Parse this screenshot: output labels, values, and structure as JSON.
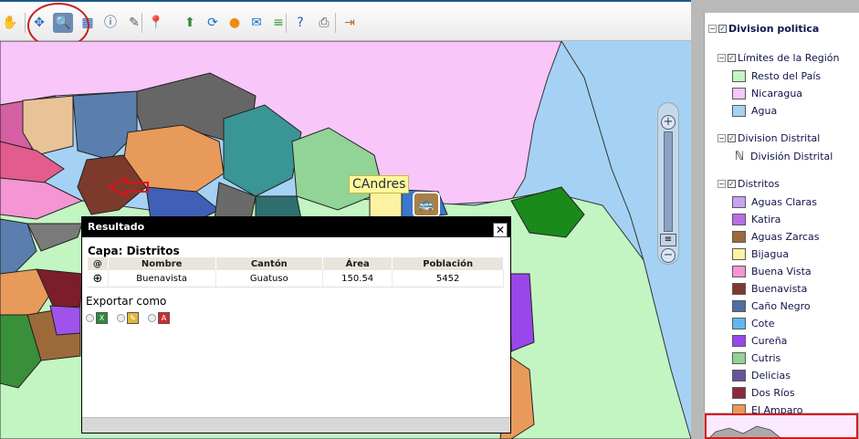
{
  "toolbar": {
    "tools": [
      {
        "icon": "hand-icon",
        "glyph": "✋",
        "color": "#c07a22"
      },
      {
        "icon": "pan-arrows-icon",
        "glyph": "✥",
        "color": "#2c6fb6"
      },
      {
        "icon": "identify-magnifier-icon",
        "glyph": "🔍",
        "color": "#1f4e8c"
      },
      {
        "icon": "select-box-icon",
        "glyph": "▦",
        "color": "#1b62b5"
      },
      {
        "icon": "info-icon",
        "glyph": "ⓘ",
        "color": "#1f4e8c"
      },
      {
        "icon": "measure-ruler-icon",
        "glyph": "✎",
        "color": "#5a5a5a"
      },
      {
        "icon": "location-pin-icon",
        "glyph": "📍",
        "color": "#b22222"
      },
      {
        "icon": "layers-up-icon",
        "glyph": "⬆",
        "color": "#2e8b3a"
      },
      {
        "icon": "refresh-icon",
        "glyph": "⟳",
        "color": "#1a6fcf"
      },
      {
        "icon": "orange-circle-icon",
        "glyph": "●",
        "color": "#f08a10"
      },
      {
        "icon": "mail-icon",
        "glyph": "✉",
        "color": "#1a6fcf"
      },
      {
        "icon": "stack-icon",
        "glyph": "≡",
        "color": "#3a9b3a"
      },
      {
        "icon": "help-icon",
        "glyph": "?",
        "color": "#1a5eb8"
      },
      {
        "icon": "print-icon",
        "glyph": "⎙",
        "color": "#555555"
      },
      {
        "icon": "exit-door-icon",
        "glyph": "⇥",
        "color": "#c06a20"
      }
    ]
  },
  "map": {
    "label": "CAndres",
    "colors": {
      "water": "#a5d2f4",
      "nicaragua": "#f8c6f9",
      "resto": "#c3f5c3"
    }
  },
  "popup": {
    "title": "Resultado",
    "close_glyph": "✕",
    "layer_label": "Capa: Distritos",
    "columns": [
      "@",
      "Nombre",
      "Cantón",
      "Área",
      "Población"
    ],
    "rows": [
      {
        "icon": "zoom-to-icon",
        "glyph": "⊕",
        "nombre": "Buenavista",
        "canton": "Guatuso",
        "area": "150.54",
        "poblacion": "5452"
      }
    ],
    "export_label": "Exportar como",
    "formats": [
      {
        "icon": "excel-icon",
        "color": "#2d8a3c",
        "letter": "X"
      },
      {
        "icon": "edit-document-icon",
        "color": "#e1b73b",
        "letter": "✎"
      },
      {
        "icon": "pdf-icon",
        "color": "#d22b2b",
        "letter": "A"
      }
    ]
  },
  "legend": {
    "groups": [
      {
        "title": "Division politica",
        "expanded": true,
        "checked": true,
        "level": 0,
        "bold": true
      },
      {
        "title": "Límites de la Región",
        "expanded": true,
        "checked": true,
        "level": 1,
        "items": [
          {
            "label": "Resto del País",
            "color": "#c3f5c3"
          },
          {
            "label": "Nicaragua",
            "color": "#f8c6f9"
          },
          {
            "label": "Agua",
            "color": "#a5d2f4"
          }
        ]
      },
      {
        "title": "Division Distrital",
        "expanded": true,
        "checked": true,
        "level": 1,
        "lines": [
          {
            "label": "División Distrital",
            "glyph": "ℕ"
          }
        ]
      },
      {
        "title": "Distritos",
        "expanded": true,
        "checked": true,
        "level": 1,
        "items": [
          {
            "label": "Aguas Claras",
            "color": "#c6a3ef"
          },
          {
            "label": "Katira",
            "color": "#b86ee6"
          },
          {
            "label": "Aguas Zarcas",
            "color": "#9c6a3a"
          },
          {
            "label": "Bijagua",
            "color": "#fbf2a2"
          },
          {
            "label": "Buena Vista",
            "color": "#f595d3"
          },
          {
            "label": "Buenavista",
            "color": "#7c3a2c"
          },
          {
            "label": "Caño Negro",
            "color": "#4f6ea3"
          },
          {
            "label": "Cote",
            "color": "#60b7ef"
          },
          {
            "label": "Cureña",
            "color": "#9a46ea"
          },
          {
            "label": "Cutris",
            "color": "#92d397"
          },
          {
            "label": "Delicias",
            "color": "#675498"
          },
          {
            "label": "Dos Ríos",
            "color": "#8a2b3d"
          },
          {
            "label": "El Amparo",
            "color": "#e89a5a"
          }
        ]
      }
    ]
  }
}
